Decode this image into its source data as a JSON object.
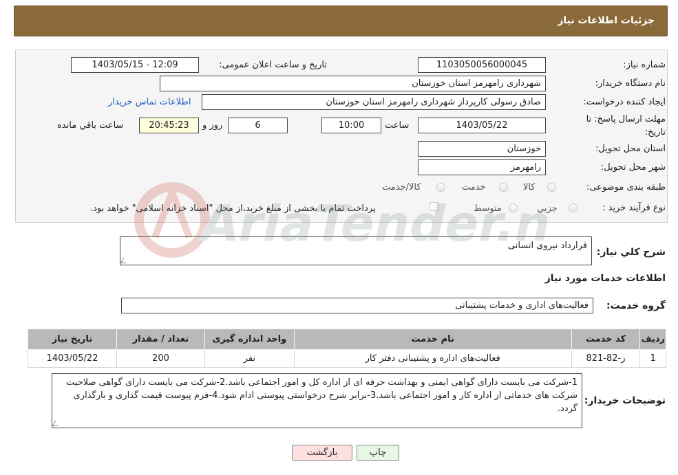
{
  "header": {
    "title": "جزئیات اطلاعات نیاز"
  },
  "fields": {
    "need_number_label": "شماره نیاز:",
    "need_number": "1103050056000045",
    "announce_label": "تاریخ و ساعت اعلان عمومی:",
    "announce_value": "1403/05/15 - 12:09",
    "buyer_org_label": "نام دستگاه خریدار:",
    "buyer_org": "شهرداری رامهرمز استان خوزستان",
    "creator_label": "ایجاد کننده درخواست:",
    "creator": "صادق رسولی کارپرداز شهرداری رامهرمز استان خوزستان",
    "contact_link": "اطلاعات تماس خریدار",
    "deadline_label": "مهلت ارسال پاسخ: تا تاریخ:",
    "deadline_date": "1403/05/22",
    "time_label": "ساعت",
    "deadline_time": "10:00",
    "days": "6",
    "days_label": "روز و",
    "remaining": "20:45:23",
    "remaining_label": "ساعت باقي مانده",
    "province_label": "استان محل تحویل:",
    "province": "خوزستان",
    "city_label": "شهر محل تحویل:",
    "city": "رامهرمز",
    "category_label": "طبقه بندی موضوعی:",
    "category_options": [
      "کالا",
      "خدمت",
      "کالا/خدمت"
    ],
    "process_label": "نوع فرآیند خرید :",
    "process_options": [
      "جزیي",
      "متوسط"
    ],
    "payment_note": "پرداخت تمام یا بخشی از مبلغ خرید،از محل \"اسناد خزانه اسلامی\" خواهد بود."
  },
  "summary": {
    "label": "شرح کلي نیاز:",
    "value": "قرارداد نیروی انسانی"
  },
  "services_section": {
    "title": "اطلاعات خدمات مورد نیاز",
    "group_label": "گروه خدمت:",
    "group_value": "فعالیت‌های اداری و خدمات پشتیبانی"
  },
  "table": {
    "headers": [
      "ردیف",
      "کد خدمت",
      "نام خدمت",
      "واحد اندازه گیری",
      "تعداد / مقدار",
      "تاریخ نیاز"
    ],
    "rows": [
      [
        "1",
        "ز-82-821",
        "فعالیت‌های اداره و پشتیبانی دفتر کار",
        "نفر",
        "200",
        "1403/05/22"
      ]
    ]
  },
  "buyer_notes": {
    "label": "توضیحات خریدار:",
    "value": "1-شرکت می بایست  دارای گواهی ایمنی و بهداشت حرفه ای از اداره کل و امور اجتماعی باشد.2-شرکت می بایست دارای گواهی صلاحیت شرکت های خدماتی  از اداره کار و امور اجتماعی باشد.3-برابر شرح درخواستی پیوستی ادام شود.4-فرم پیوست قیمت گذاری و بارگذاری گردد."
  },
  "buttons": {
    "print": "چاپ",
    "back": "بازگشت"
  },
  "watermark": {
    "text": "AriaTender.net"
  },
  "colors": {
    "header_bg": "#8b6a3a",
    "link": "#1f5fbf",
    "back_btn": "#fde0e0",
    "print_btn": "#e6f7e6"
  }
}
